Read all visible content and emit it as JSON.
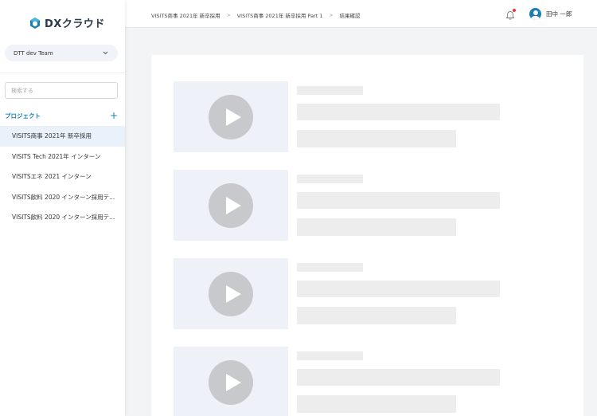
{
  "app": {
    "logo_text": "DXクラウド"
  },
  "sidebar": {
    "team_select": {
      "label": "DTT dev Team"
    },
    "search": {
      "placeholder": "検索する"
    },
    "projects_title": "プロジェクト",
    "projects": [
      "VISITS商事 2021年 新卒採用",
      "VISITS Tech 2021年 インターン",
      "VISITSエネ 2021 インターン",
      "VISITS飲料 2020 インターン採用テ...",
      "VISITS飲料 2020 インターン採用テ..."
    ],
    "active_index": 0
  },
  "header": {
    "breadcrumb": [
      "VISITS商事 2021年 新卒採用",
      "VISITS商事 2021年 新卒採用 Part 1",
      "結果確認"
    ],
    "user_name": "田中 一郎"
  },
  "colors": {
    "accent": "#1a7fb5",
    "notification_dot": "#e53935",
    "active_item_bg": "#e9f2fb",
    "skeleton": "#ededed"
  },
  "icons": {
    "logo": "dx-logo-icon",
    "team_chevron": "chevron-down-icon",
    "add_project": "plus-icon",
    "breadcrumb_sep": "chevron-right-icon",
    "notification": "bell-icon",
    "user": "user-avatar-icon",
    "video": "play-icon"
  },
  "video_placeholders": 4
}
